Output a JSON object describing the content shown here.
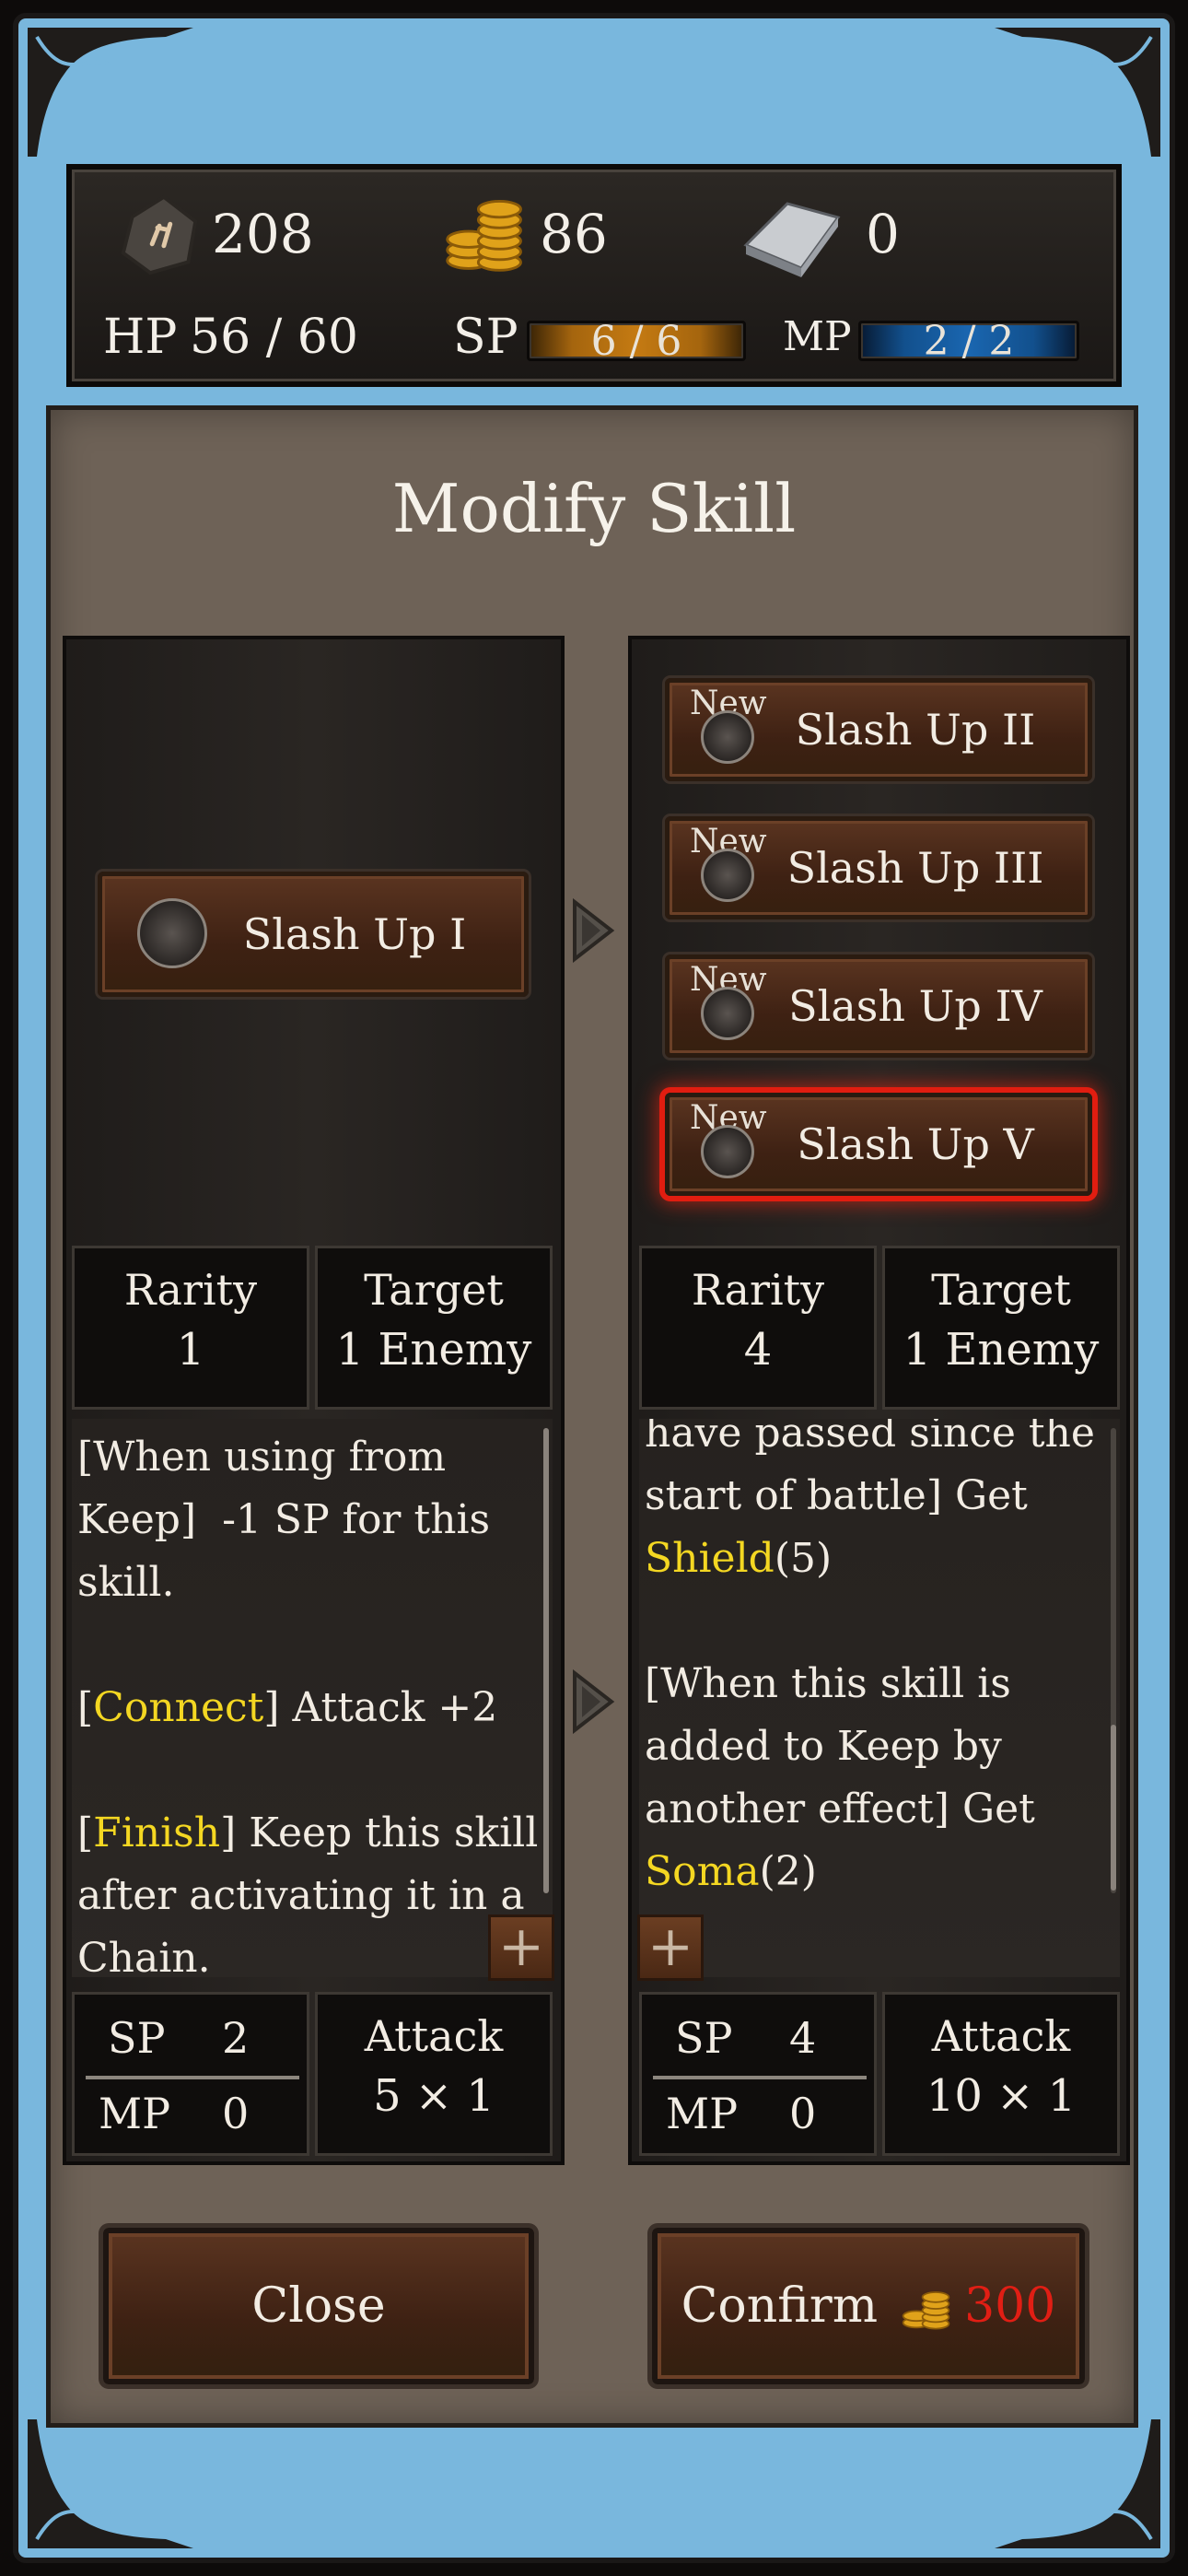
{
  "resources": {
    "soul": "208",
    "gold": "86",
    "ingot": "0"
  },
  "status": {
    "hp_label": "HP",
    "hp_value": "56 / 60",
    "sp_label": "SP",
    "sp_value": "6 / 6",
    "mp_label": "MP",
    "mp_value": "2 / 2"
  },
  "dialog": {
    "title": "Modify Skill",
    "current": {
      "skill_name": "Slash Up I",
      "rarity_label": "Rarity",
      "rarity": "1",
      "target_label": "Target",
      "target": "1 Enemy",
      "description": [
        {
          "text": "[When using from\nKeep]  -1 SP for this\nskill.\n\n["
        },
        {
          "text": "Connect",
          "hl": true
        },
        {
          "text": "] Attack +2\n\n["
        },
        {
          "text": "Finish",
          "hl": true
        },
        {
          "text": "] Keep this skill\nafter activating it in a\nChain."
        }
      ],
      "sp_label": "SP",
      "sp": "2",
      "mp_label": "MP",
      "mp": "0",
      "attack_label": "Attack",
      "attack": "5 × 1"
    },
    "options": [
      {
        "new": "New",
        "name": "Slash Up II",
        "selected": false
      },
      {
        "new": "New",
        "name": "Slash Up III",
        "selected": false
      },
      {
        "new": "New",
        "name": "Slash Up IV",
        "selected": false
      },
      {
        "new": "New",
        "name": "Slash Up V",
        "selected": true
      }
    ],
    "preview": {
      "rarity_label": "Rarity",
      "rarity": "4",
      "target_label": "Target",
      "target": "1 Enemy",
      "description": [
        {
          "text": "have passed since the\nstart of battle] Get\n"
        },
        {
          "text": "Shield",
          "hl": true
        },
        {
          "text": "(5)\n\n[When this skill is\nadded to Keep by\nanother effect] Get\n"
        },
        {
          "text": "Soma",
          "hl": true
        },
        {
          "text": "(2)"
        }
      ],
      "sp_label": "SP",
      "sp": "4",
      "mp_label": "MP",
      "mp": "0",
      "attack_label": "Attack",
      "attack": "10 × 1"
    },
    "buttons": {
      "close": "Close",
      "confirm": "Confirm",
      "confirm_price": "300"
    }
  },
  "plus_symbol": "+",
  "colors": {
    "highlight": "#f4d722",
    "selection": "#e11d10",
    "price": "#e11e14"
  }
}
